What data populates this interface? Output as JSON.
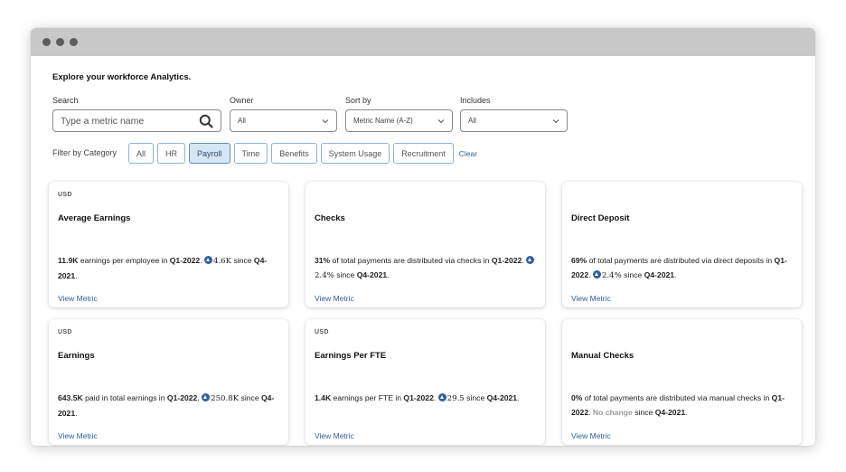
{
  "page": {
    "heading": "Explore your workforce Analytics."
  },
  "filters": {
    "search_label": "Search",
    "search_placeholder": "Type a metric name",
    "owner_label": "Owner",
    "owner_value": "All",
    "sort_label": "Sort by",
    "sort_value": "Metric Name (A-Z)",
    "includes_label": "Includes",
    "includes_value": "All"
  },
  "categories": {
    "label": "Filter by Category",
    "items": [
      "All",
      "HR",
      "Payroll",
      "Time",
      "Benefits",
      "System Usage",
      "Recruitment"
    ],
    "active": "Payroll",
    "clear_label": "Clear"
  },
  "cards": [
    {
      "currency": "USD",
      "title": "Average Earnings",
      "value": "11.9K",
      "text1": " earnings per employee in ",
      "period": "Q1-2022",
      "text2": ". ",
      "change": "4.6K",
      "text3": " since ",
      "prev": "Q4-2021",
      "text4": ".",
      "link": "View Metric"
    },
    {
      "currency": "",
      "title": "Checks",
      "value": "31%",
      "text1": " of total payments are distributed via checks in ",
      "period": "Q1-2022",
      "text2": ". ",
      "change": "2.4%",
      "text3": " since ",
      "prev": "Q4-2021",
      "text4": ".",
      "link": "View Metric"
    },
    {
      "currency": "",
      "title": "Direct Deposit",
      "value": "69%",
      "text1": " of total payments are distributed via direct deposits in ",
      "period": "Q1-2022",
      "text2": ". ",
      "change": "2.4%",
      "text3": " since ",
      "prev": "Q4-2021",
      "text4": ".",
      "link": "View Metric"
    },
    {
      "currency": "USD",
      "title": "Earnings",
      "value": "643.5K",
      "text1": " paid in total earnings in ",
      "period": "Q1-2022",
      "text2": ". ",
      "change": "250.8K",
      "text3": " since ",
      "prev": "Q4-2021",
      "text4": ".",
      "link": "View Metric"
    },
    {
      "currency": "USD",
      "title": "Earnings Per FTE",
      "value": "1.4K",
      "text1": " earnings per FTE in ",
      "period": "Q1-2022",
      "text2": ". ",
      "change": "29.5",
      "text3": " since ",
      "prev": "Q4-2021",
      "text4": ".",
      "link": "View Metric"
    },
    {
      "currency": "",
      "title": "Manual Checks",
      "value": "0%",
      "text1": " of total payments are distributed via manual checks in ",
      "period": "Q1-2022",
      "text2": ". ",
      "no_change": "No change",
      "text3": " since ",
      "prev": "Q4-2021",
      "text4": ".",
      "link": "View Metric"
    }
  ],
  "colors": {
    "accent": "#2e5f9e",
    "pill_border": "#8fb3d4",
    "pill_active_bg": "#d6e6f5",
    "titlebar": "#c8c8c8",
    "no_change": "#9a9a9a"
  },
  "icons": {
    "search": "search-icon",
    "dropdown": "chevron-down-icon",
    "change": "arrow-up-circle-icon"
  }
}
